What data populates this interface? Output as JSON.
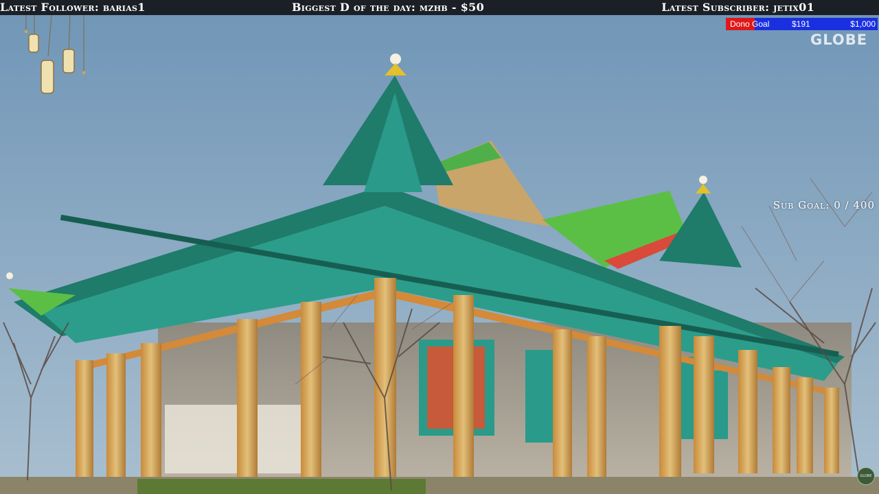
{
  "topbar": {
    "latest_follower": "Latest Follower: barias1",
    "biggest_dono": "Biggest D of the day: mzhb - $50",
    "latest_subscriber": "Latest Subscriber: jetix01"
  },
  "dono_goal": {
    "label": "Dono Goal",
    "current": "$191",
    "target": "$1,000",
    "progress_fraction": 0.191,
    "fill_color": "#e01818",
    "track_color": "#1a2fe0"
  },
  "brand_logo": "GLOBE",
  "sub_goal": "Sub Goal: 0 / 400",
  "corner_badge": "GLOBE"
}
